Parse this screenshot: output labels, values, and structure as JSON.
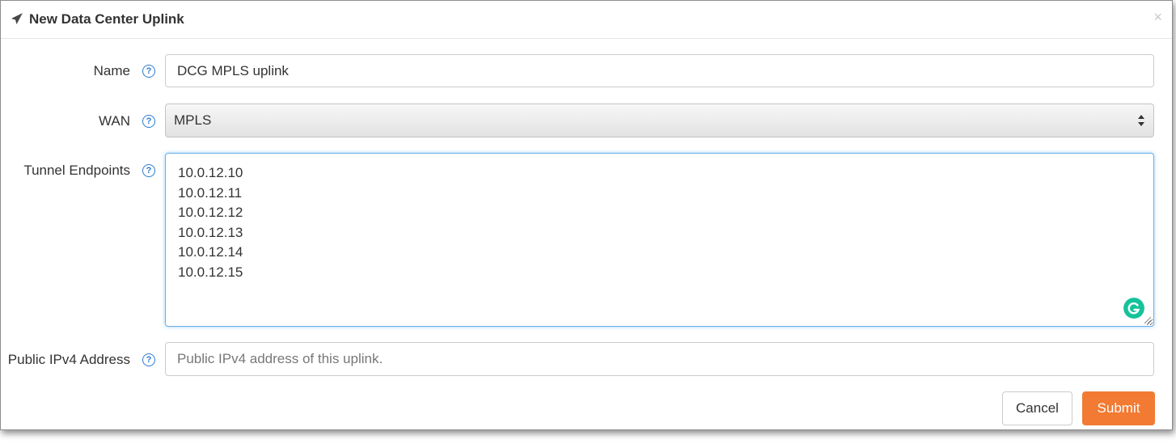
{
  "dialog": {
    "title": "New Data Center Uplink",
    "header_icon": "paper-plane-icon",
    "close_label": "×"
  },
  "form": {
    "name": {
      "label": "Name",
      "help_icon": "question-circle-icon",
      "help_glyph": "?",
      "value": "DCG MPLS uplink"
    },
    "wan": {
      "label": "WAN",
      "help_icon": "question-circle-icon",
      "help_glyph": "?",
      "selected": "MPLS"
    },
    "tunnel_endpoints": {
      "label": "Tunnel Endpoints",
      "help_icon": "question-circle-icon",
      "help_glyph": "?",
      "lines": [
        "10.0.12.10",
        "10.0.12.11",
        "10.0.12.12",
        "10.0.12.13",
        "10.0.12.14",
        "10.0.12.15"
      ]
    },
    "public_ipv4": {
      "label": "Public IPv4 Address",
      "help_icon": "question-circle-icon",
      "help_glyph": "?",
      "value": "",
      "placeholder": "Public IPv4 address of this uplink."
    }
  },
  "buttons": {
    "cancel": "Cancel",
    "submit": "Submit"
  },
  "colors": {
    "accent": "#f27a32",
    "help": "#2a7ad2",
    "focus": "#66afe9",
    "grammarly": "#15c39a"
  }
}
